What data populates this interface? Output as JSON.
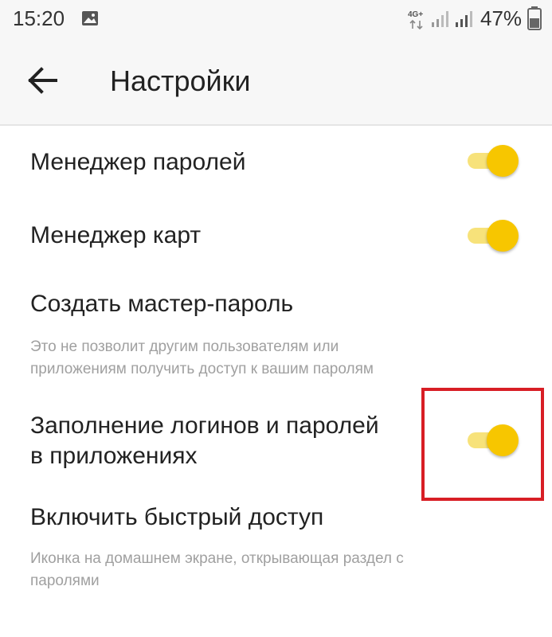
{
  "status_bar": {
    "time": "15:20",
    "network": "4G+",
    "battery": "47%"
  },
  "app_bar": {
    "title": "Настройки"
  },
  "settings": [
    {
      "title": "Менеджер паролей",
      "toggle_on": true
    },
    {
      "title": "Менеджер карт",
      "toggle_on": true
    },
    {
      "title": "Создать мастер-пароль",
      "subtitle_lines": [
        "Это не позволит другим пользователям или",
        "приложениям получить доступ к вашим паролям"
      ]
    },
    {
      "title_lines": [
        "Заполнение логинов и паролей",
        "в приложениях"
      ],
      "toggle_on": true,
      "highlighted": true
    },
    {
      "title": "Включить быстрый доступ",
      "subtitle_lines": [
        "Иконка на домашнем экране, открывающая раздел с",
        "паролями"
      ]
    }
  ],
  "colors": {
    "accent": "#f7c600",
    "track": "#f7e27a",
    "highlight_box": "#d81e25",
    "secondary_text": "#a0a0a0"
  }
}
